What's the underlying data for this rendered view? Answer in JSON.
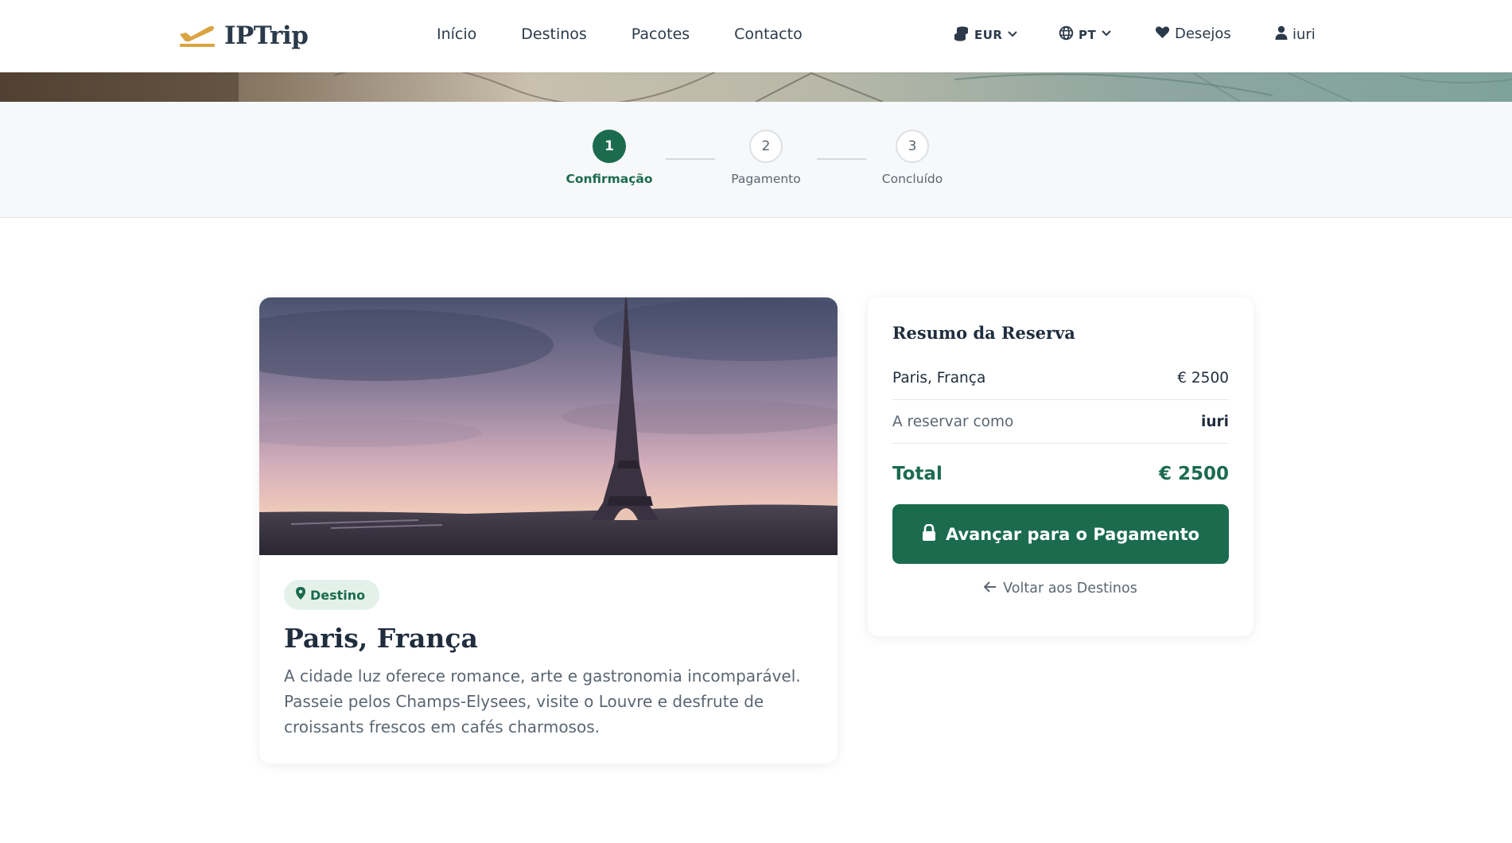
{
  "brand": {
    "name": "IPTrip",
    "accent": "#1b6b4f",
    "logo_color": "#d9a441"
  },
  "nav": {
    "items": [
      "Início",
      "Destinos",
      "Pacotes",
      "Contacto"
    ]
  },
  "header": {
    "currency": "EUR",
    "language": "PT",
    "wishlist": "Desejos",
    "user": "iuri"
  },
  "steps": [
    {
      "number": "1",
      "label": "Confirmação",
      "active": true
    },
    {
      "number": "2",
      "label": "Pagamento",
      "active": false
    },
    {
      "number": "3",
      "label": "Concluído",
      "active": false
    }
  ],
  "destination": {
    "badge": "Destino",
    "title": "Paris, França",
    "description": "A cidade luz oferece romance, arte e gastronomia incomparável. Passeie pelos Champs-Elysees, visite o Louvre e desfrute de croissants frescos em cafés charmosos."
  },
  "summary": {
    "title": "Resumo da Reserva",
    "rows": [
      {
        "key": "Paris, França",
        "value": "€ 2500"
      },
      {
        "key": "A reservar como",
        "value": "iuri"
      }
    ],
    "total_label": "Total",
    "total_value": "€ 2500",
    "pay_button": "Avançar para o Pagamento",
    "back_link": "Voltar aos Destinos"
  }
}
